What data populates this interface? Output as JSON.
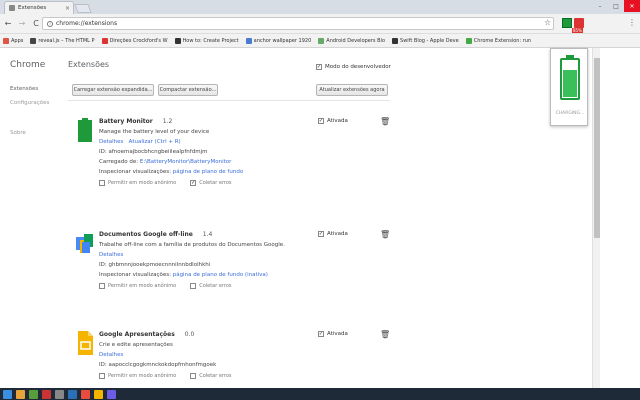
{
  "tab": {
    "title": "Extensões",
    "close": "×"
  },
  "window": {
    "min": "–",
    "max": "□",
    "close": "✕"
  },
  "toolbar": {
    "back": "←",
    "forward": "→",
    "reload": "C",
    "url": "chrome://extensions",
    "star": "☆",
    "menu": "⋮",
    "ext_badge": "85%"
  },
  "bookmarks": [
    {
      "label": "Apps",
      "color": "#d54"
    },
    {
      "label": "reveal.js – The HTML P",
      "color": "#444"
    },
    {
      "label": "Direções Crockford's W",
      "color": "#d33"
    },
    {
      "label": "How to: Create Project",
      "color": "#333"
    },
    {
      "label": "anchor wallpaper 1920",
      "color": "#4a7bd1"
    },
    {
      "label": "Android Developers Blo",
      "color": "#6a6"
    },
    {
      "label": "Swift Blog - Apple Deve",
      "color": "#333"
    },
    {
      "label": "Chrome Extension: run",
      "color": "#4a4"
    }
  ],
  "sidebar": {
    "title": "Chrome",
    "items": [
      {
        "label": "Extensões"
      },
      {
        "label": "Configurações"
      },
      {
        "label": "Sobre"
      }
    ]
  },
  "main": {
    "title": "Extensões",
    "dev_mode": "Modo do desenvolvedor",
    "buttons": {
      "load_unpacked": "Carregar extensão expandida...",
      "pack": "Compactar extensão...",
      "update": "Atualizar extensões agora"
    }
  },
  "labels": {
    "enabled": "Ativada",
    "trash": "🗑",
    "check": "✓",
    "details": "Detalhes",
    "update_link": "Atualizar (Ctrl + R)",
    "id_prefix": "ID: ",
    "loaded_from": "Carregado de: ",
    "inspect": "Inspecionar visualizações: ",
    "incognito": "Permitir em modo anônimo",
    "collect_errors": "Coletar erros"
  },
  "extensions": [
    {
      "name": "Battery Monitor",
      "version": "1.2",
      "description": "Manage the battery level of your device",
      "id": "afnoemajbocbhcngbeiilealpfnfdmjm",
      "path": "E:\\BatteryMonitor\\BatteryMonitor",
      "inspect_link": "página de plano de fundo"
    },
    {
      "name": "Documentos Google off-line",
      "version": "1.4",
      "description": "Trabalhe off-line com a família de produtos do Documentos Google.",
      "id": "ghbmnnjooekpmoecnnnilnnbdlolhkhi",
      "inspect_link": "página de plano de fundo (inativa)"
    },
    {
      "name": "Google Apresentações",
      "version": "0.0",
      "description": "Crie e edite apresentações",
      "id": "aapocclcgogkmnckokdopfmhonfmgoek"
    }
  ],
  "popup": {
    "status": "CHARGING..."
  },
  "colors": {
    "accent_link": "#3a6dd8",
    "battery_green": "#1e9a3a",
    "battery_fill": "#39c05b"
  },
  "battery_level": 0.72
}
